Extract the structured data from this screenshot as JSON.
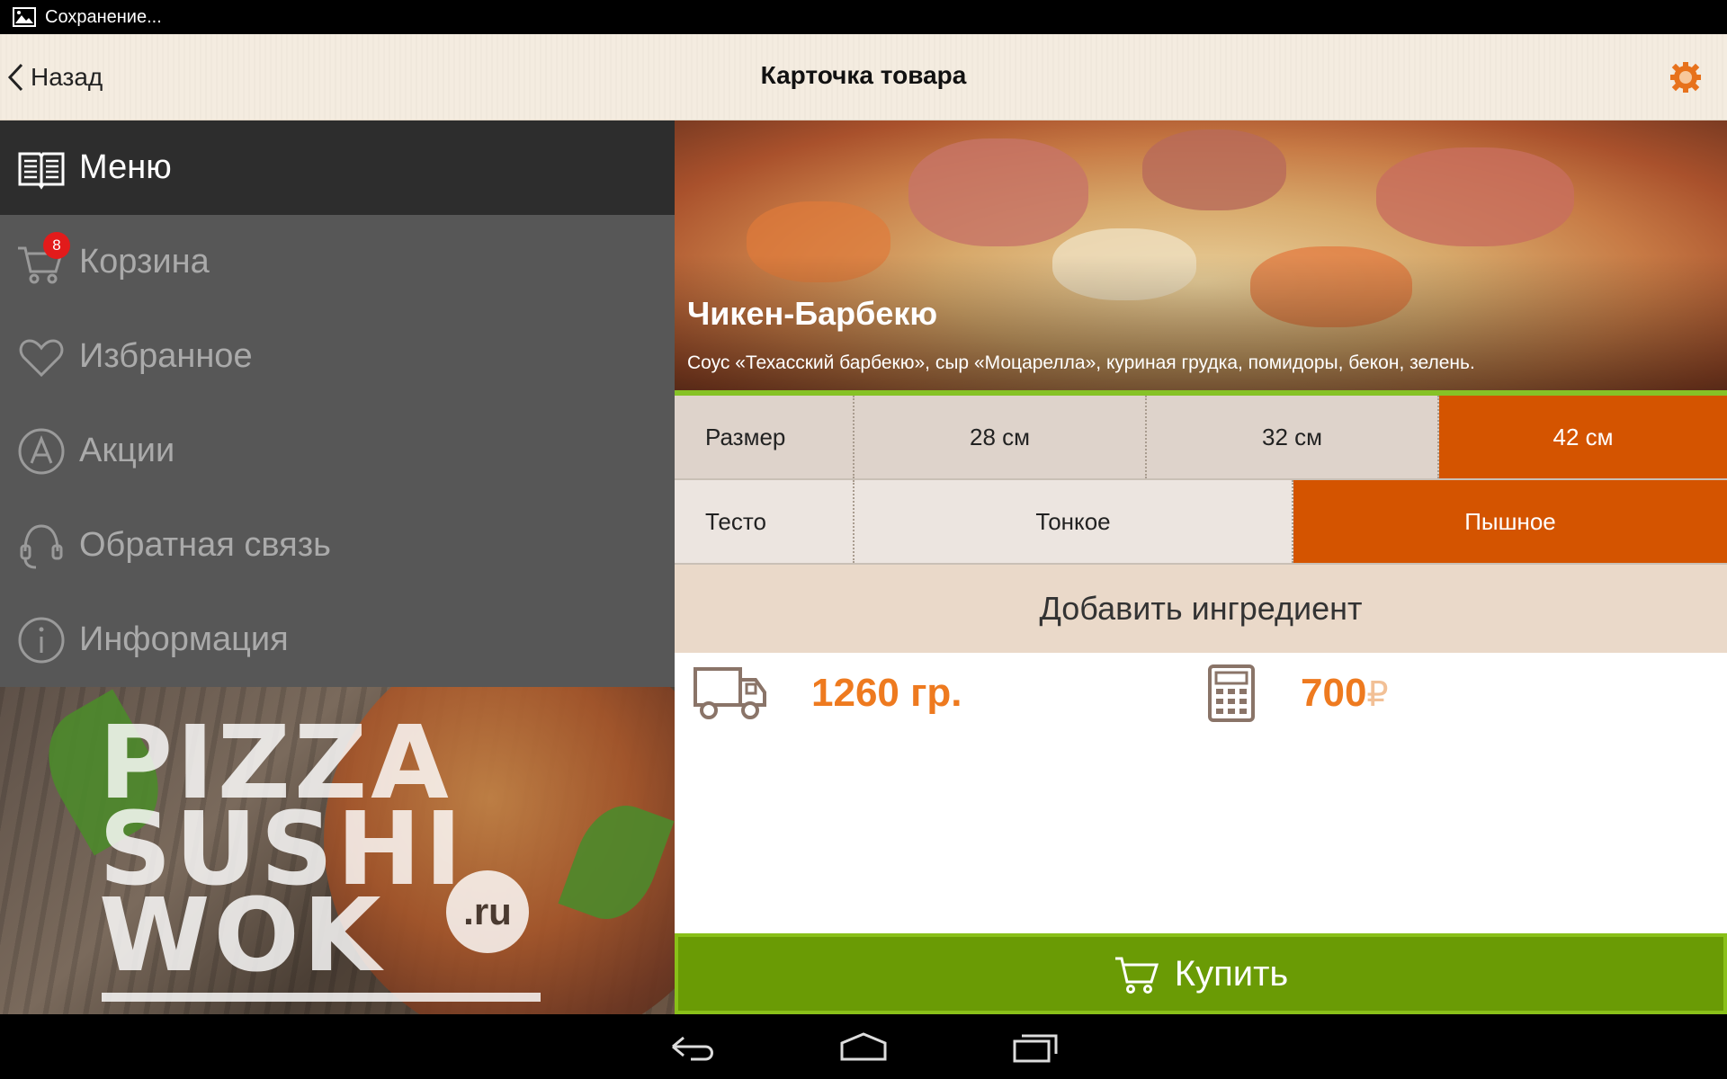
{
  "status_bar": {
    "text": "Сохранение...",
    "icon": "image-icon"
  },
  "action_bar": {
    "back_label": "Назад",
    "title": "Карточка товара",
    "settings_icon": "gear-icon"
  },
  "sidebar": {
    "items": [
      {
        "label": "Меню",
        "icon": "book-icon",
        "active": true
      },
      {
        "label": "Корзина",
        "icon": "cart-icon",
        "badge": "8"
      },
      {
        "label": "Избранное",
        "icon": "heart-icon"
      },
      {
        "label": "Акции",
        "icon": "letter-a-icon"
      },
      {
        "label": "Обратная связь",
        "icon": "headset-icon"
      },
      {
        "label": "Информация",
        "icon": "info-icon"
      }
    ]
  },
  "promo": {
    "line1": "PIZZA",
    "line2": "SUSHI",
    "line3": "WOK",
    "domain": ".ru"
  },
  "product": {
    "name": "Чикен-Барбекю",
    "description": "Соус «Техасский барбекю», сыр «Моцарелла», куриная грудка, помидоры, бекон, зелень.",
    "size": {
      "label": "Размер",
      "options": [
        "28 см",
        "32 см",
        "42 см"
      ],
      "selected": "42 см"
    },
    "dough": {
      "label": "Тесто",
      "options": [
        "Тонкое",
        "Пышное"
      ],
      "selected": "Пышное"
    },
    "add_ingredient_label": "Добавить ингредиент",
    "weight": "1260 гр.",
    "price": "700",
    "currency": "₽",
    "buy_label": "Купить"
  },
  "colors": {
    "accent_orange": "#d45400",
    "price_orange": "#ee7a1f",
    "buy_green": "#6a9b05",
    "badge_red": "#e21b1b"
  },
  "nav_bar": {
    "icons": [
      "back-icon",
      "home-icon",
      "recents-icon"
    ]
  }
}
